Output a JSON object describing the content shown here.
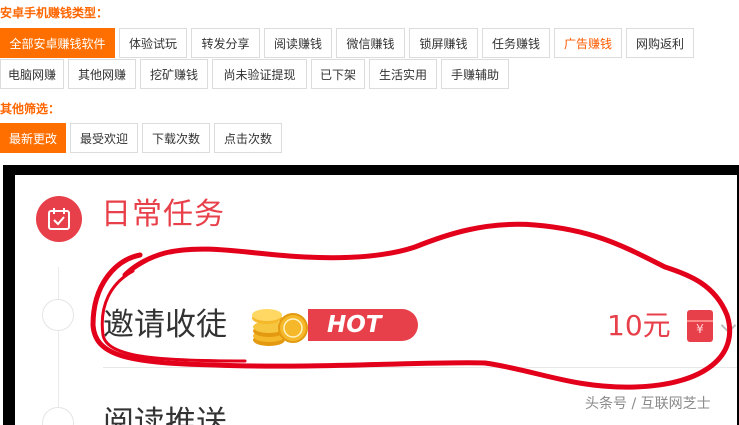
{
  "filters": {
    "type_label": "安卓手机赚钱类型：",
    "type_tags_row1": [
      "全部安卓赚钱软件",
      "体验试玩",
      "转发分享",
      "阅读赚钱",
      "微信赚钱",
      "锁屏赚钱",
      "任务赚钱",
      "广告赚钱",
      "网购返利"
    ],
    "type_tags_row2": [
      "电脑网赚",
      "其他网赚",
      "挖矿赚钱",
      "尚未验证提现",
      "已下架",
      "生活实用",
      "手赚辅助"
    ],
    "other_label": "其他筛选：",
    "sort_tags": [
      "最新更改",
      "最受欢迎",
      "下载次数",
      "点击次数"
    ]
  },
  "task_panel": {
    "title": "日常任务",
    "task1": {
      "title": "邀请收徒",
      "badge": "HOT",
      "reward": "10元",
      "redpacket_char": "¥"
    },
    "task2": {
      "title": "阅读推送"
    }
  },
  "watermark": "头条号 / 互联网芝士",
  "colors": {
    "accent": "#ff6f00",
    "brand_red": "#e8404a",
    "frame": "#000000",
    "annotation": "#e3001a"
  },
  "icons": [
    "calendar-check-icon",
    "coins-icon",
    "red-packet-icon",
    "chevron-down-icon"
  ]
}
